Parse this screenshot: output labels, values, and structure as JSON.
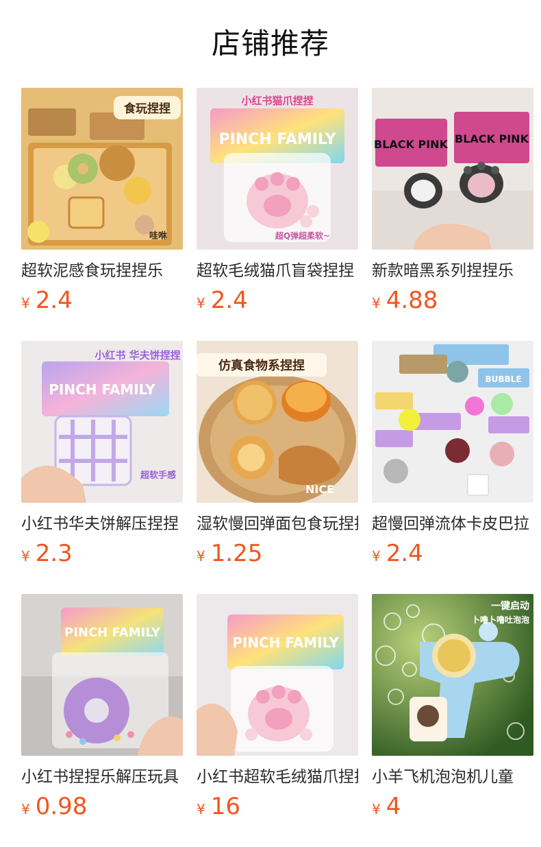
{
  "header": {
    "title": "店铺推荐"
  },
  "currency_symbol": "¥",
  "products": [
    {
      "name": "超软泥感食玩捏捏乐",
      "price": "2.4",
      "image": {
        "tag": "食玩捏捏",
        "corner": "哇咻",
        "bg": "#e9c27a",
        "accent": "#c8862f"
      }
    },
    {
      "name": "超软毛绒猫爪盲袋捏捏",
      "price": "2.4",
      "image": {
        "tag": "小红书猫爪捏捏",
        "pack": "PINCH FAMILY",
        "bottom": "超Q弹超柔软~",
        "bg": "#f4eef0",
        "accent": "#f4a7c2"
      }
    },
    {
      "name": "新款暗黑系列捏捏乐",
      "price": "4.88",
      "image": {
        "pack": "BLACK PINK",
        "bg": "#eeeae8",
        "accent": "#d24f9a"
      }
    },
    {
      "name": "小红书华夫饼解压捏捏",
      "price": "2.3",
      "image": {
        "tag": "小红书 华夫饼捏捏",
        "pack": "PINCH FAMILY",
        "bottom": "超软手感",
        "bg": "#f1ecec",
        "accent": "#b07de0"
      }
    },
    {
      "name": "湿软慢回弹面包食玩捏捏",
      "price": "1.25",
      "image": {
        "tag": "仿真食物系捏捏",
        "bottom": "NICE",
        "bg": "#f2e6d7",
        "accent": "#e59a3a"
      }
    },
    {
      "name": "超慢回弹流体卡皮巴拉",
      "price": "2.4",
      "image": {
        "pack": "BUBBLE",
        "bg": "#eeeeee",
        "accent": "#8ec3ea"
      }
    },
    {
      "name": "小红书捏捏乐解压玩具",
      "price": "0.98",
      "image": {
        "pack": "PINCH FAMILY",
        "bg": "#d9d7d5",
        "accent": "#b68ed8"
      }
    },
    {
      "name": "小红书超软毛绒猫爪捏捏",
      "price": "16",
      "image": {
        "pack": "PINCH FAMILY",
        "bg": "#f2eeee",
        "accent": "#f4a7c2"
      }
    },
    {
      "name": "小羊飞机泡泡机儿童",
      "price": "4",
      "image": {
        "tag": "一键启动",
        "tag2": "卜噜卜噜吐泡泡",
        "bg": "#5f8f3f",
        "accent": "#8fc9e6"
      }
    }
  ]
}
